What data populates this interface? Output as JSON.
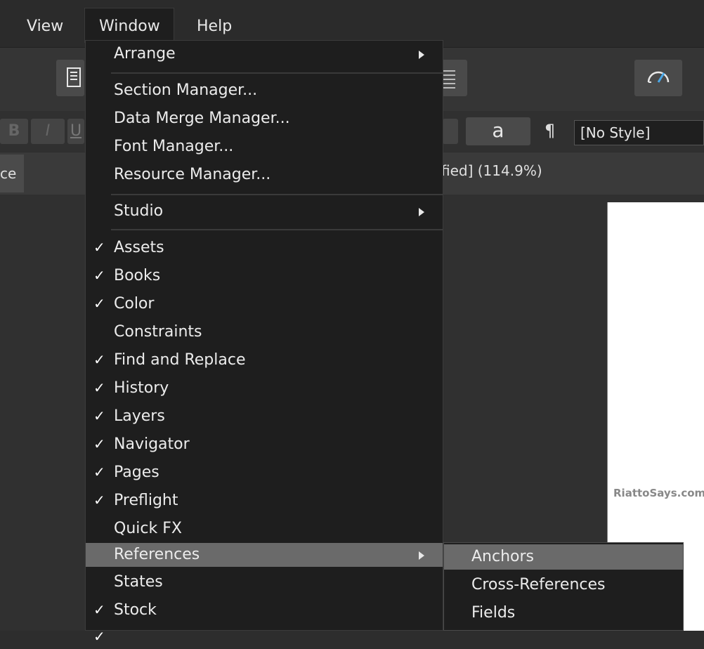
{
  "menubar": {
    "view": "View",
    "window": "Window",
    "help": "Help"
  },
  "context": {
    "bold": "B",
    "italic": "I",
    "underline": "U",
    "char_a": "a",
    "pilcrow": "¶",
    "style": "[No Style]"
  },
  "tabs": {
    "left_tab_fragment": "ce",
    "doc_title_fragment": "fied] (114.9%)"
  },
  "canvas": {
    "watermark": "RiattoSays.com ©"
  },
  "window_menu": {
    "arrange": "Arrange",
    "section_manager": "Section Manager...",
    "data_merge_manager": "Data Merge Manager...",
    "font_manager": "Font Manager...",
    "resource_manager": "Resource Manager...",
    "studio": "Studio",
    "check_glyph": "✓",
    "assets": "Assets",
    "books": "Books",
    "color": "Color",
    "constraints": "Constraints",
    "find_replace": "Find and Replace",
    "history": "History",
    "layers": "Layers",
    "navigator": "Navigator",
    "pages": "Pages",
    "preflight": "Preflight",
    "quick_fx": "Quick FX",
    "references": "References",
    "states": "States",
    "stock": "Stock"
  },
  "references_submenu": {
    "anchors": "Anchors",
    "cross_references": "Cross-References",
    "fields": "Fields"
  },
  "colors": {
    "menu_bg": "#1e1e1e",
    "highlight": "#6a6a6a",
    "app_bg": "#2d2d2d"
  },
  "icons": [
    "document-icon",
    "align-icon",
    "speedometer-icon",
    "check-icon",
    "submenu-arrow-icon"
  ]
}
